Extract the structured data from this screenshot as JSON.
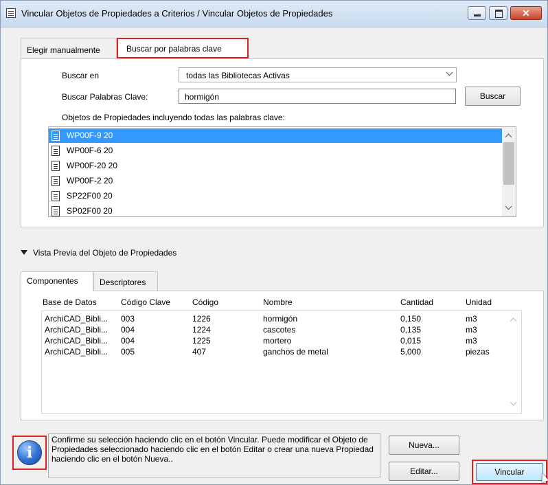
{
  "window": {
    "title": "Vincular Objetos de Propiedades a Criterios / Vincular Objetos de Propiedades",
    "close_glyph": "✕"
  },
  "tabs": [
    {
      "label": "Elegir manualmente"
    },
    {
      "label": "Buscar por palabras clave"
    }
  ],
  "search": {
    "search_in_label": "Buscar en",
    "search_in_value": "todas las Bibliotecas Activas",
    "keywords_label": "Buscar Palabras Clave:",
    "keywords_value": "hormigón",
    "search_button": "Buscar",
    "results_label": "Objetos de Propiedades incluyendo todas las palabras clave:"
  },
  "results": [
    {
      "label": "WP00F-9 20"
    },
    {
      "label": "WP00F-6 20"
    },
    {
      "label": "WP00F-20 20"
    },
    {
      "label": "WP00F-2 20"
    },
    {
      "label": "SP22F00 20"
    },
    {
      "label": "SP02F00 20"
    }
  ],
  "preview": {
    "title": "Vista Previa del Objeto de Propiedades",
    "tabs": [
      {
        "label": "Componentes"
      },
      {
        "label": "Descriptores"
      }
    ],
    "columns": [
      "Base de Datos",
      "Código Clave",
      "Código",
      "Nombre",
      "Cantidad",
      "Unidad"
    ],
    "rows": [
      [
        "ArchiCAD_Bibli...",
        "003",
        "1226",
        "hormigón",
        "0,150",
        "m3"
      ],
      [
        "ArchiCAD_Bibli...",
        "004",
        "1224",
        "cascotes",
        "0,135",
        "m3"
      ],
      [
        "ArchiCAD_Bibli...",
        "004",
        "1225",
        "mortero",
        "0,015",
        "m3"
      ],
      [
        "ArchiCAD_Bibli...",
        "005",
        "407",
        "ganchos de metal",
        "5,000",
        "piezas"
      ]
    ]
  },
  "info": {
    "icon_letter": "i",
    "text": "Confirme su selección haciendo clic en el botón Vincular. Puede modificar el Objeto de Propiedades seleccionado haciendo clic en el botón Editar o crear una nueva Propiedad haciendo clic en el botón Nueva.."
  },
  "buttons": {
    "new": "Nueva...",
    "edit": "Editar...",
    "link": "Vincular"
  },
  "colors": {
    "highlight": "#e02020",
    "selection": "#3399ff"
  }
}
